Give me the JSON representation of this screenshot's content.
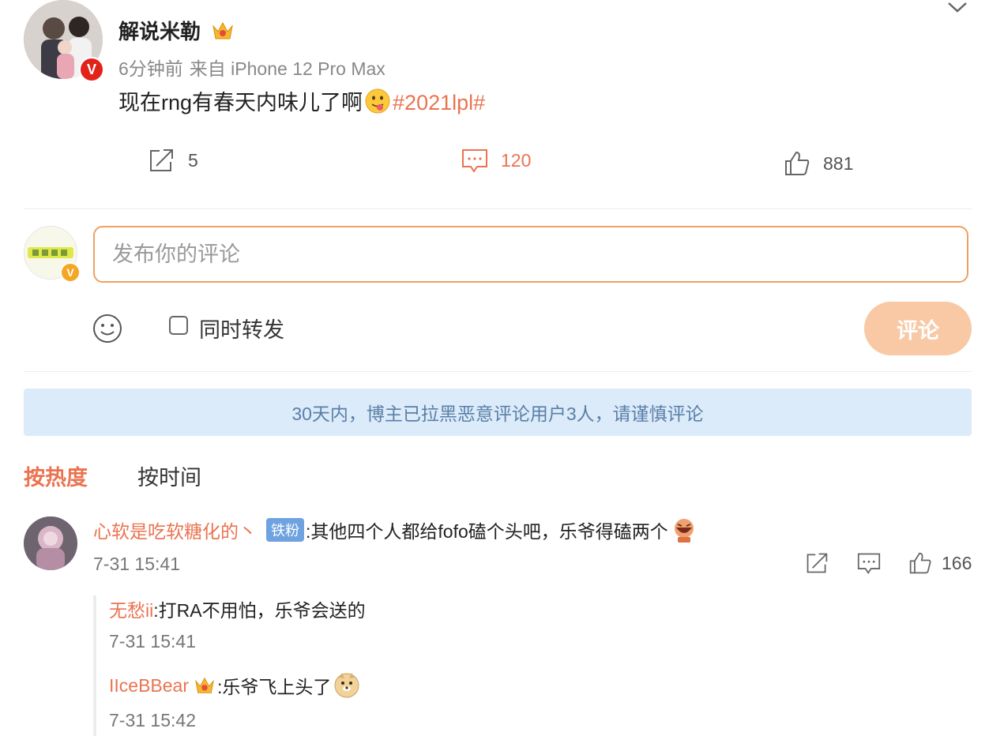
{
  "post": {
    "author": "解说米勒",
    "time": "6分钟前",
    "source": "来自 iPhone 12 Pro Max",
    "text": "现在rng有春天内味儿了啊",
    "hashtag": "#2021lpl#",
    "repost_count": "5",
    "comment_count": "120",
    "like_count": "881"
  },
  "composer": {
    "placeholder": "发布你的评论",
    "repost_label": "同时转发",
    "submit_label": "评论"
  },
  "notice": "30天内，博主已拉黑恶意评论用户3人，请谨慎评论",
  "sort": {
    "hot": "按热度",
    "time": "按时间"
  },
  "comment": {
    "user": "心软是吃软糖化的丶",
    "badge": "铁粉",
    "text": ":其他四个人都给fofo磕个头吧，乐爷得磕两个",
    "time": "7-31 15:41",
    "like_count": "166"
  },
  "replies": [
    {
      "user": "无愁ii",
      "text": ":打RA不用怕，乐爷会送的",
      "time": "7-31 15:41"
    },
    {
      "user": "IIceBBear",
      "text": ":乐爷飞上头了",
      "time": "7-31 15:42"
    }
  ],
  "colors": {
    "accent": "#eb7350",
    "notice_bg": "#dbebf9",
    "submit_disabled": "#f8c9a4"
  }
}
